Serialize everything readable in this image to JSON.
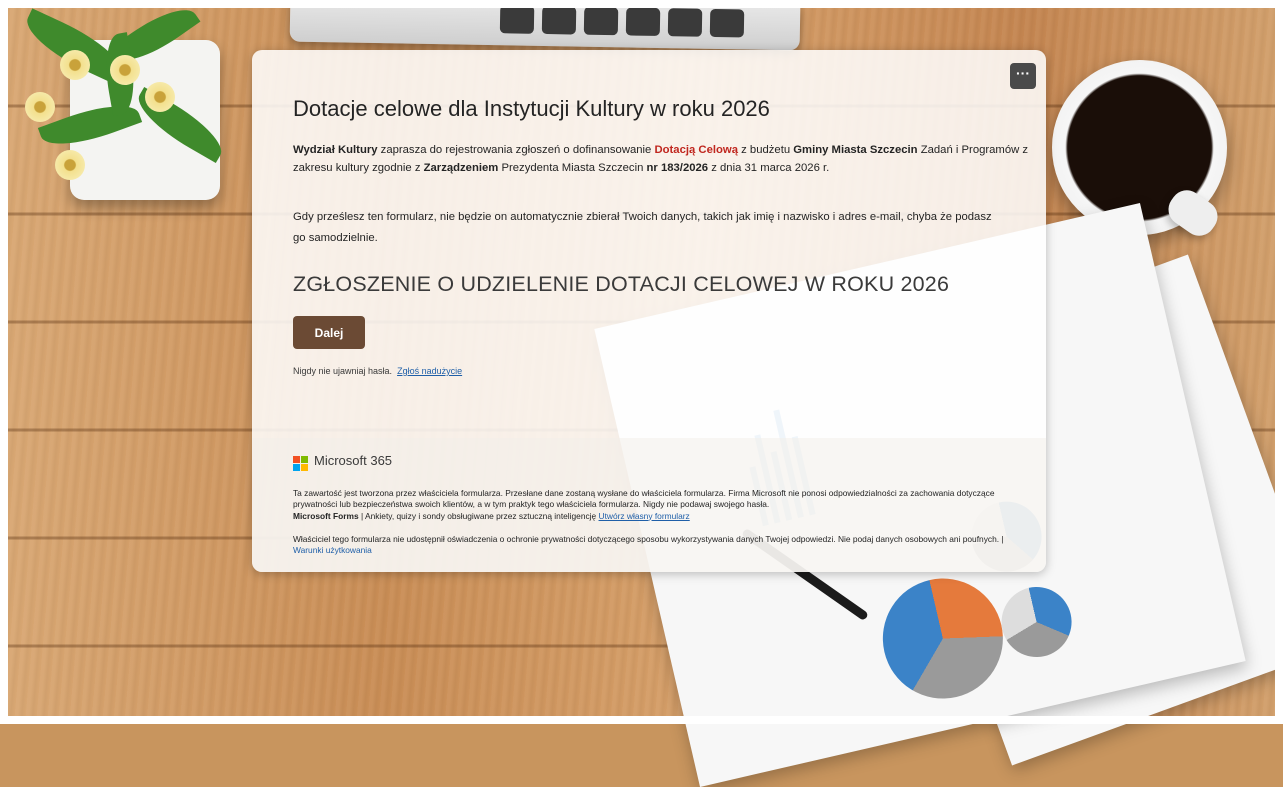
{
  "form": {
    "title": "Dotacje celowe dla Instytucji Kultury w roku 2026",
    "intro": {
      "part1_bold": "Wydział Kultury",
      "part2": " zaprasza do rejestrowania zgłoszeń o dofinansowanie ",
      "part3_red": "Dotacją Celową",
      "part4": " z budżetu ",
      "part5_bold": "Gminy Miasta Szczecin",
      "part6": " Zadań i Programów z zakresu kultury  zgodnie z ",
      "part7_bold": "Zarządzeniem",
      "part8": " Prezydenta Miasta Szczecin ",
      "part9_bold": "nr 183/2026",
      "part10": " z dnia 31 marca 2026 r."
    },
    "privacy_note": "Gdy prześlesz ten formularz, nie będzie on automatycznie zbierał Twoich danych, takich jak imię i nazwisko i adres e-mail, chyba że podasz go samodzielnie.",
    "section_title": "ZGŁOSZENIE O UDZIELENIE DOTACJI CELOWEJ W ROKU 2026",
    "next_label": "Dalej",
    "more_label": "···",
    "password_note": "Nigdy nie ujawniaj hasła.",
    "report_link": "Zgłoś nadużycie"
  },
  "footer": {
    "brand": "Microsoft 365",
    "disclaimer": "Ta zawartość jest tworzona przez właściciela formularza. Przesłane dane zostaną wysłane do właściciela formularza. Firma Microsoft nie ponosi odpowiedzialności za zachowania dotyczące prywatności lub bezpieczeństwa swoich klientów, a w tym praktyk tego właściciela formularza. Nigdy nie podawaj swojego hasła.",
    "forms_brand": "Microsoft Forms",
    "forms_desc": " | Ankiety, quizy i sondy obsługiwane przez sztuczną inteligencję ",
    "create_link": "Utwórz własny formularz",
    "owner_note": "Właściciel tego formularza nie udostępnił oświadczenia o ochronie prywatności dotyczącego sposobu wykorzystywania danych Twojej odpowiedzi. Nie podaj danych osobowych ani poufnych. | ",
    "terms_link": "Warunki użytkowania"
  },
  "icons": {
    "more": "more-options-icon",
    "logo": "microsoft-logo-icon"
  },
  "colors": {
    "accent": "#6b4a34",
    "highlight_red": "#c0271f",
    "link": "#1f5fa8",
    "ms_red": "#f25022",
    "ms_green": "#7fba00",
    "ms_blue": "#00a4ef",
    "ms_yellow": "#ffb900"
  }
}
